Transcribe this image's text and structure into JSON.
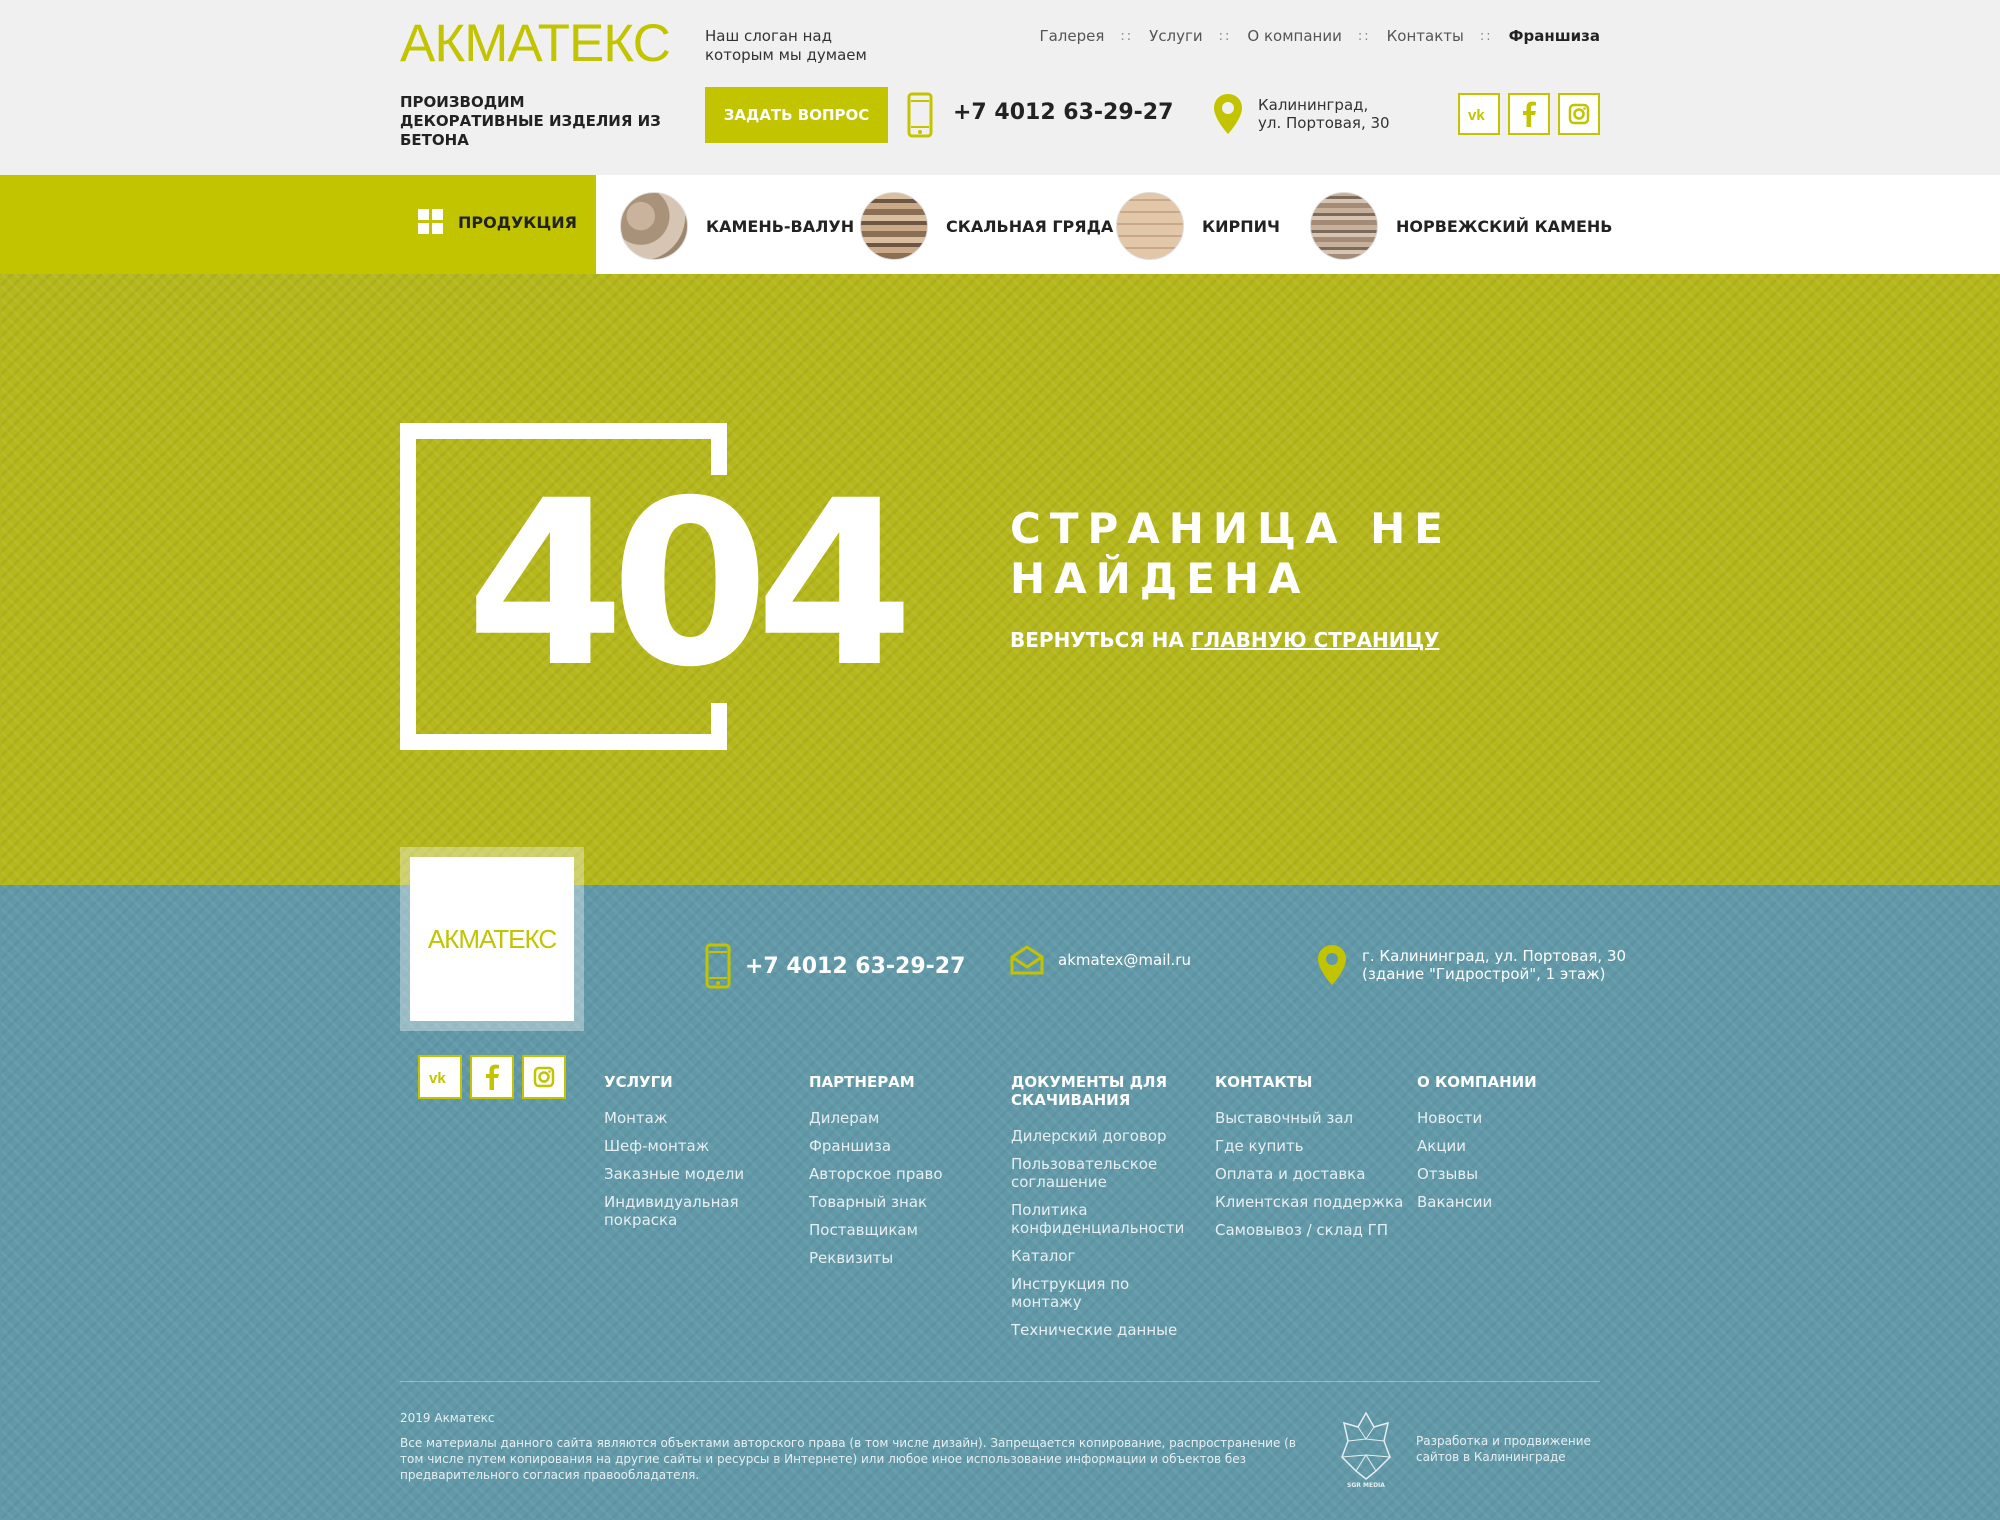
{
  "header": {
    "logo": "АКМАТЕКС",
    "slogan": "Наш слоган над которым мы думаем",
    "nav": [
      "Галерея",
      "Услуги",
      "О компании",
      "Контакты",
      "Франшиза"
    ],
    "nav_separator": "::",
    "tagline": "ПРОИЗВОДИМ ДЕКОРАТИВНЫЕ ИЗДЕЛИЯ ИЗ БЕТОНА",
    "ask_button": "ЗАДАТЬ ВОПРОС",
    "phone": "+7 4012 63-29-27",
    "address_line1": "Калининград,",
    "address_line2": "ул. Портовая, 30"
  },
  "products_nav": {
    "main": "ПРОДУКЦИЯ",
    "items": [
      "КАМЕНЬ-ВАЛУН",
      "СКАЛЬНАЯ ГРЯДА",
      "КИРПИЧ",
      "НОРВЕЖСКИЙ КАМЕНЬ"
    ]
  },
  "error": {
    "code": "404",
    "title_line1": "СТРАНИЦА НЕ",
    "title_line2": "НАЙДЕНА",
    "back_prefix": "ВЕРНУТЬСЯ НА",
    "back_link": "ГЛАВНУЮ СТРАНИЦУ"
  },
  "footer": {
    "logo": "АКМАТЕКС",
    "phone": "+7 4012 63-29-27",
    "email": "akmatex@mail.ru",
    "address_line1": "г. Калининград, ул. Портовая, 30",
    "address_line2": "(здание \"Гидрострой\", 1 этаж)",
    "columns": [
      {
        "title": "УСЛУГИ",
        "links": [
          "Монтаж",
          "Шеф-монтаж",
          "Заказные модели",
          "Индивидуальная покраска"
        ]
      },
      {
        "title": "ПАРТНЕРАМ",
        "links": [
          "Дилерам",
          "Франшиза",
          "Авторское право",
          "Товарный знак",
          "Поставщикам",
          "Реквизиты"
        ]
      },
      {
        "title": "ДОКУМЕНТЫ ДЛЯ СКАЧИВАНИЯ",
        "links": [
          "Дилерский договор",
          "Пользовательское соглашение",
          "Политика конфиденциальности",
          "Каталог",
          "Инструкция по монтажу",
          "Технические данные"
        ]
      },
      {
        "title": "КОНТАКТЫ",
        "links": [
          "Выставочный зал",
          "Где купить",
          "Оплата и доставка",
          "Клиентская поддержка",
          "Самовывоз / склад ГП"
        ]
      },
      {
        "title": "О КОМПАНИИ",
        "links": [
          "Новости",
          "Акции",
          "Отзывы",
          "Вакансии"
        ]
      }
    ],
    "copyright_year": "2019 Акматекс",
    "copyright_text": "Все материалы данного сайта являются объектами авторского права (в том числе дизайн). Запрещается копирование, распространение (в том числе путем копирования на другие сайты и ресурсы в Интернете) или любое иное использование информации и объектов без предварительного согласия правообладателя.",
    "dev_logo_text": "SGR MEDIA",
    "dev_text": "Разработка и продвижение сайтов в Калининграде"
  },
  "colors": {
    "accent": "#c2c400",
    "error_bg": "#b5b81a",
    "footer_bg": "#6199a8"
  },
  "icons": [
    "grid-icon",
    "phone-icon",
    "map-pin-icon",
    "vk-icon",
    "facebook-icon",
    "instagram-icon",
    "mail-icon",
    "rhino-logo-icon"
  ]
}
